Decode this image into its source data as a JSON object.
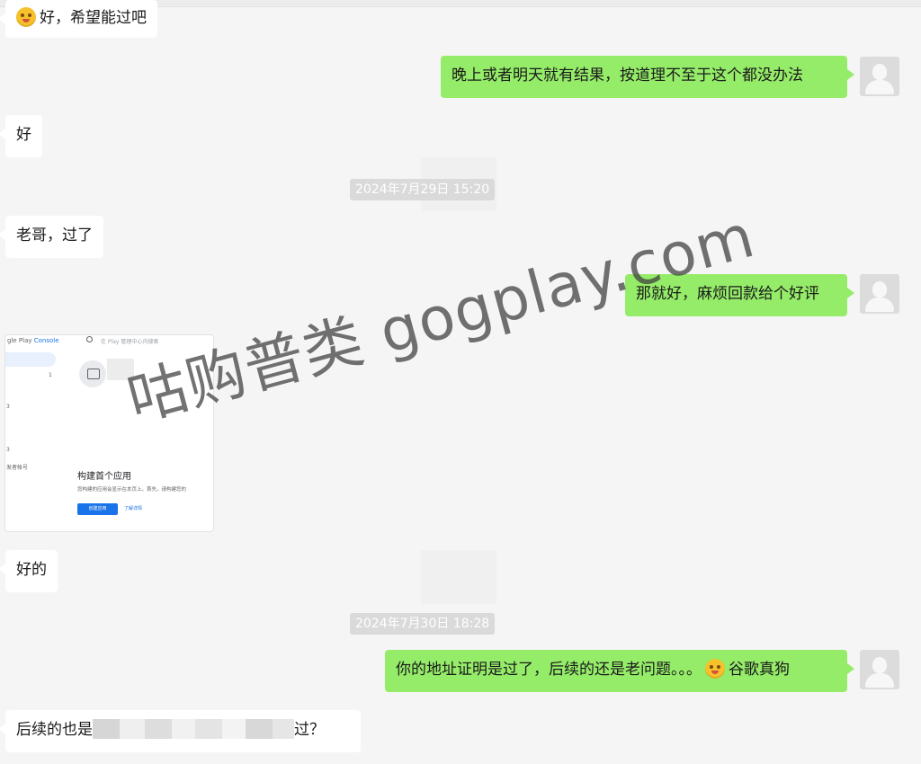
{
  "messages": {
    "m1": {
      "text": "好，希望能过吧",
      "emoji": "嘿哈-face"
    },
    "m2": {
      "text": "晚上或者明天就有结果，按道理不至于这个都没办法"
    },
    "m3": {
      "text": "好"
    },
    "ts1": "2024年7月29日 15:20",
    "m4": {
      "text": "老哥，过了"
    },
    "m5": {
      "text": "那就好，麻烦回款给个好评"
    },
    "m6": {
      "text": "好的"
    },
    "ts2": "2024年7月30日 18:28",
    "m7": {
      "text": "你的地址证明是过了，后续的还是老问题。。。",
      "text_after_emoji": "谷歌真狗",
      "emoji": "crazy-face"
    },
    "m8": {
      "text_before": "后续的也是",
      "text_after": "过？"
    }
  },
  "screenshot_card": {
    "console_logo": "gle Play ",
    "console_logo_accent": "Console",
    "search_placeholder": "在 Play 管理中心内搜索",
    "side_labels": [
      "1",
      "3",
      "3",
      "发者帐号"
    ],
    "title": "构建首个应用",
    "desc": "您构建的应用会显示在本页上。首先，请构建您的",
    "primary_button": "创建应用",
    "link_button": "了解详情"
  },
  "watermark": "咕购普类 gogplay.com",
  "colors": {
    "chat_bg": "#f5f5f5",
    "sent_bubble": "#95ec69",
    "received_bubble": "#ffffff",
    "timestamp_bg": "#dadada"
  }
}
